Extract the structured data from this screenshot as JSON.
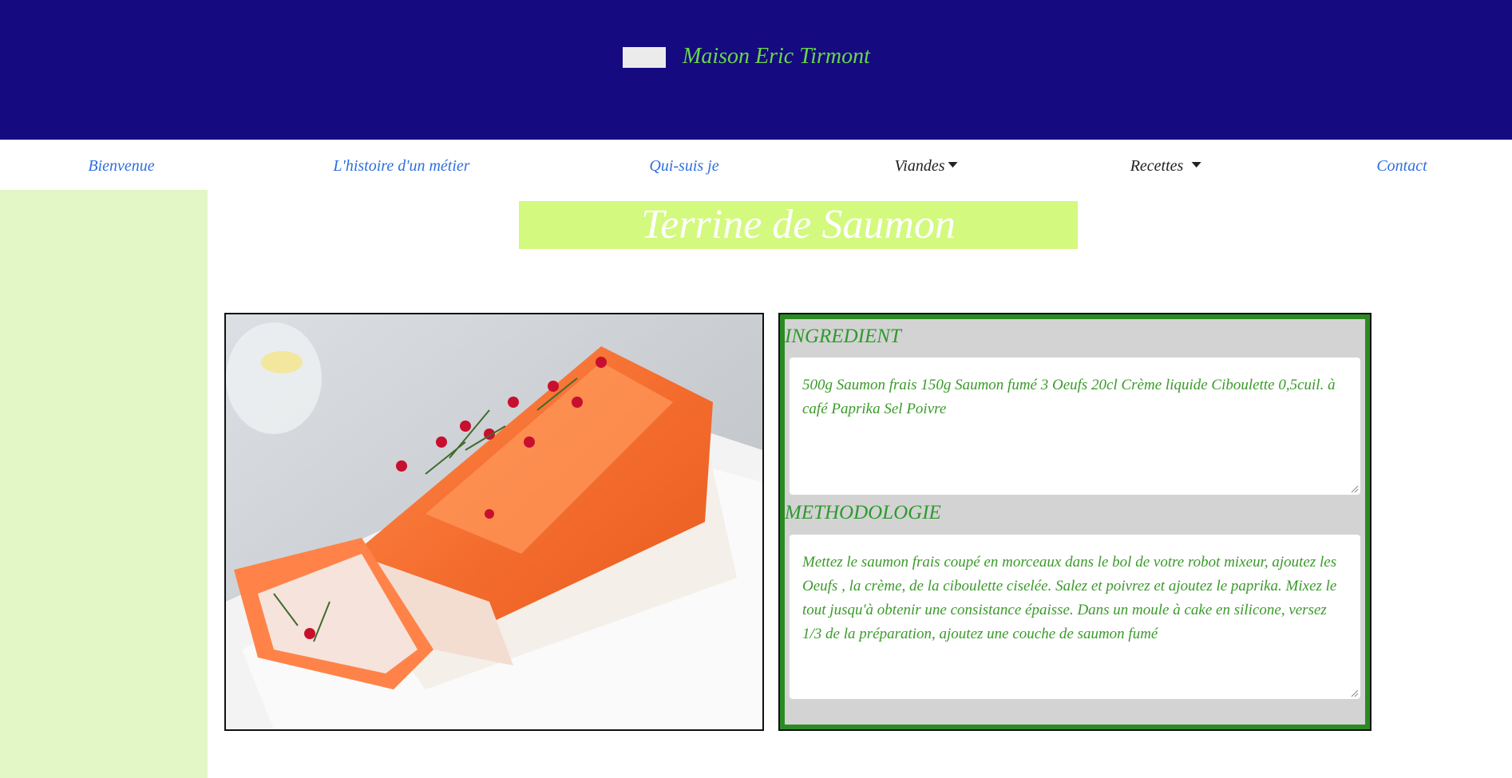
{
  "header": {
    "site_title": "Maison Eric Tirmont",
    "background": "#150a80",
    "title_color": "#6ad64a"
  },
  "nav": {
    "items": [
      {
        "label": "Bienvenue"
      },
      {
        "label": "L'histoire d'un métier"
      },
      {
        "label": "Qui-suis je"
      },
      {
        "label": "Viandes",
        "dropdown": true
      },
      {
        "label": "Recettes",
        "dropdown": true
      },
      {
        "label": "Contact"
      }
    ],
    "link_color": "#2e6fe0"
  },
  "page": {
    "title": "Terrine de Saumon",
    "title_bg": "#d3f97f",
    "sidebar_bg": "#e2f6c6"
  },
  "photo": {
    "subject": "salmon-terrine-photo"
  },
  "recipe": {
    "ingredient_label": "INGREDIENT",
    "ingredient_text": "500g Saumon frais 150g Saumon fumé 3 Oeufs 20cl Crème liquide Ciboulette 0,5cuil. à café Paprika Sel Poivre",
    "method_label": "METHODOLOGIE",
    "method_text": "Mettez le saumon frais coupé en morceaux dans le bol de votre robot mixeur, ajoutez les Oeufs , la crème, de la ciboulette ciselée. Salez et poivrez et ajoutez le paprika. Mixez le tout jusqu'à obtenir une consistance épaisse. Dans un moule à cake en silicone, versez 1/3 de la préparation, ajoutez une couche de saumon fumé",
    "text_color": "#3a9a2a",
    "panel_border": "#2c8a23"
  }
}
